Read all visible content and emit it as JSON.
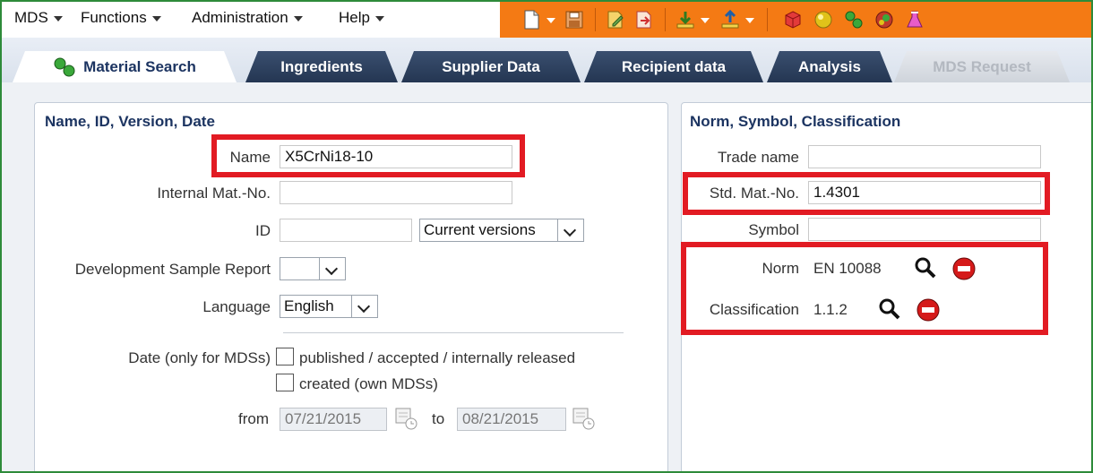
{
  "menubar": {
    "items": [
      {
        "label": "MDS"
      },
      {
        "label": "Functions"
      },
      {
        "label": "Administration"
      },
      {
        "label": "Help"
      }
    ]
  },
  "tabs": [
    {
      "label": "Material Search",
      "state": "active"
    },
    {
      "label": "Ingredients"
    },
    {
      "label": "Supplier Data"
    },
    {
      "label": "Recipient data"
    },
    {
      "label": "Analysis"
    },
    {
      "label": "MDS Request",
      "state": "disabled"
    }
  ],
  "left_panel": {
    "title": "Name, ID, Version, Date",
    "name_label": "Name",
    "name_value": "X5CrNi18-10",
    "internal_label": "Internal Mat.-No.",
    "internal_value": "",
    "id_label": "ID",
    "id_value": "",
    "version_select": "Current versions",
    "dev_label": "Development Sample Report",
    "dev_select": "",
    "language_label": "Language",
    "language_select": "English",
    "date_label": "Date (only for MDSs)",
    "check1_label": "published / accepted / internally released",
    "check2_label": "created (own MDSs)",
    "from_label": "from",
    "from_value": "07/21/2015",
    "to_label": "to",
    "to_value": "08/21/2015"
  },
  "right_panel": {
    "title": "Norm, Symbol, Classification",
    "trade_label": "Trade name",
    "trade_value": "",
    "std_label": "Std. Mat.-No.",
    "std_value": "1.4301",
    "symbol_label": "Symbol",
    "symbol_value": "",
    "norm_label": "Norm",
    "norm_value": "EN 10088",
    "class_label": "Classification",
    "class_value": "1.1.2"
  },
  "colors": {
    "toolbar": "#f47a14",
    "tab_dark": "#243652",
    "heading": "#1c3461",
    "highlight": "#e21b23",
    "frame": "#2e8b3a"
  }
}
